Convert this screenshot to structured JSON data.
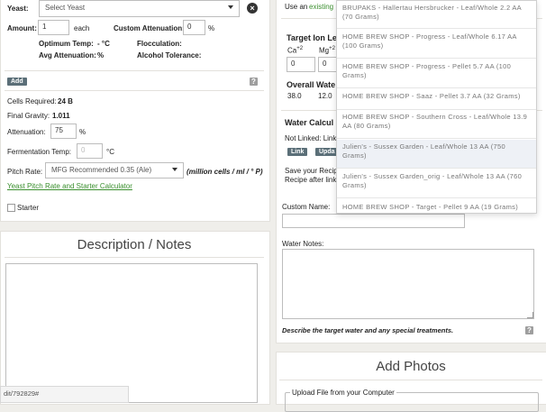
{
  "yeast": {
    "label": "Yeast:",
    "select_value": "Select Yeast",
    "amount_label": "Amount:",
    "amount_value": "1",
    "amount_unit": "each",
    "custom_atten_label": "Custom Attenuation:",
    "custom_atten_value": "0",
    "custom_atten_unit": "%",
    "opt_temp_label": "Optimum Temp:",
    "opt_temp_value": "- °C",
    "flocculation_label": "Flocculation:",
    "avg_atten_label": "Avg Attenuation:",
    "avg_atten_value": "%",
    "alcohol_tol_label": "Alcohol Tolerance:",
    "add_label": "Add",
    "help_label": "?"
  },
  "fermentation": {
    "cells_label": "Cells Required:",
    "cells_value": "24 B",
    "fg_label": "Final Gravity:",
    "fg_value": "1.011",
    "atten_label": "Attenuation:",
    "atten_value": "75",
    "atten_unit": "%",
    "temp_label": "Fermentation Temp:",
    "temp_placeholder": "0",
    "temp_unit": "°C",
    "pitch_label": "Pitch Rate:",
    "pitch_value": "MFG Recommended 0.35 (Ale)",
    "pitch_unit": "(million cells / ml / ° P)",
    "calc_link": "Yeast Pitch Rate and Starter Calculator",
    "starter_label": "Starter"
  },
  "description": {
    "title": "Description / Notes",
    "url_fragment": "dit/792829#"
  },
  "water": {
    "use_an_text": "Use an",
    "existing_text": "existing",
    "target_ion_title": "Target Ion Le",
    "ca_label": "Ca",
    "ca_sup": "+2",
    "mg_label": "Mg",
    "mg_sup": "+2",
    "ca_value": "0",
    "mg_value": "0",
    "overall_title": "Overall Wate",
    "overall_ca": "38.0",
    "overall_mg": "12.0",
    "water_calc_title": "Water Calcul",
    "not_linked_text": "Not Linked: Link",
    "link_btn": "Link",
    "update_btn": "Upda",
    "save_recipe_text_1": "Save your Recip",
    "save_recipe_text_2": "Recipe after link",
    "custom_name_label": "Custom Name:",
    "water_notes_label": "Water Notes:",
    "describe_text": "Describe the target water and any special treatments.",
    "help_label": "?"
  },
  "photos": {
    "title": "Add Photos",
    "upload_label": "Upload File from your Computer"
  },
  "hop_dropdown": {
    "items": [
      "BRUPAKS - Hallertau Hersbrucker - Leaf/Whole 2.2 AA (70 Grams)",
      "HOME BREW SHOP - Progress - Leaf/Whole 6.17 AA (100 Grams)",
      "HOME BREW SHOP - Progress - Pellet 5.7 AA (100 Grams)",
      "HOME BREW SHOP - Saaz - Pellet 3.7 AA (32 Grams)",
      "HOME BREW SHOP - Southern Cross - Leaf/Whole 13.9 AA (80 Grams)",
      "Julien's - Sussex Garden - Leaf/Whole 13 AA (750 Grams)",
      "Julien's - Sussex Garden_orig - Leaf/Whole 13 AA (760 Grams)",
      "HOME BREW SHOP - Target - Pellet 9 AA (19 Grams)"
    ]
  },
  "colors": {
    "link_green": "#3a8f2e",
    "button_slate": "#5b6f78",
    "highlight": "#eef1f6"
  }
}
